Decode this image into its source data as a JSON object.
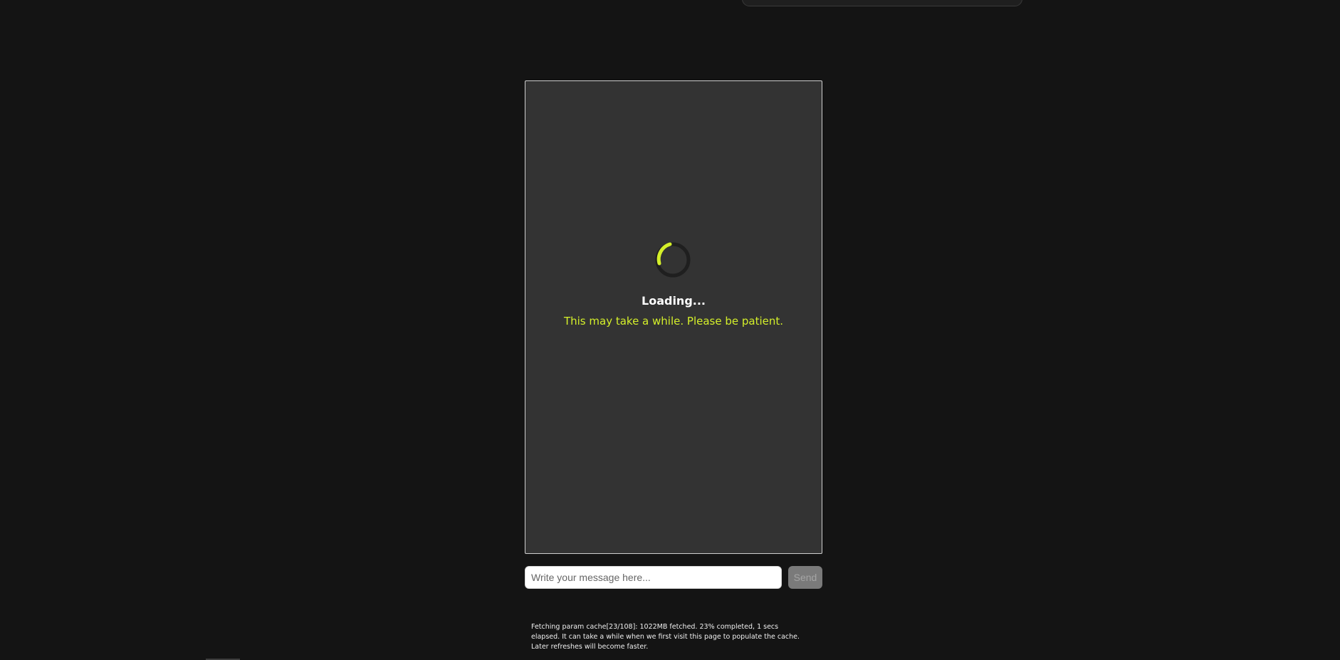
{
  "loading": {
    "title": "Loading...",
    "subtitle": "This may take a while. Please be patient."
  },
  "chat": {
    "input_placeholder": "Write your message here...",
    "send_label": "Send"
  },
  "status": {
    "message": "Fetching param cache[23/108]: 1022MB fetched. 23% completed, 1 secs elapsed. It can take a while when we first visit this page to populate the cache. Later refreshes will become faster.",
    "percent_complete": 23
  },
  "colors": {
    "background": "#141414",
    "panel": "#333333",
    "accent": "#d4ef2a",
    "spinner_track": "#1f1f1f",
    "send_button_disabled": "#7a7a7a"
  },
  "icons": {
    "spinner": "spinner-icon"
  }
}
